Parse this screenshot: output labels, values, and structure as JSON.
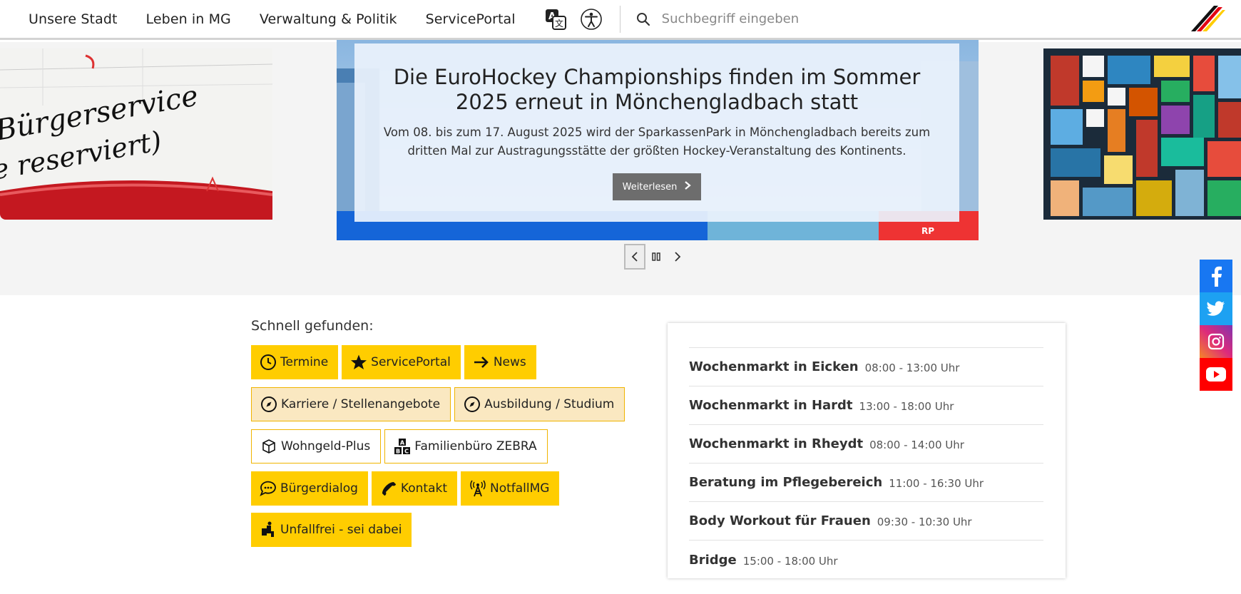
{
  "nav": {
    "items": [
      "Unsere Stadt",
      "Leben in MG",
      "Verwaltung & Politik",
      "ServicePortal"
    ]
  },
  "search": {
    "placeholder": "Suchbegriff eingeben"
  },
  "slider": {
    "left_slide_text": [
      "Bürgerservice",
      "e reserviert)"
    ],
    "title": "Die EuroHockey Championships finden im Sommer 2025 erneut in Mönchengladbach statt",
    "text": "Vom 08. bis zum 17. August 2025 wird der SparkassenPark in Mönchengladbach bereits zum dritten Mal zur Austragungsstätte der größten Hockey-Veranstaltung des Kontinents.",
    "more_label": "Weiterlesen",
    "banner_text": "RP"
  },
  "quick": {
    "title": "Schnell gefunden:",
    "rows": [
      [
        {
          "label": "Termine",
          "icon": "clock-icon"
        },
        {
          "label": "ServicePortal",
          "icon": "star-icon"
        },
        {
          "label": "News",
          "icon": "arrow-right-icon"
        }
      ],
      [
        {
          "label": "Karriere / Stellenangebote",
          "icon": "compass-icon"
        },
        {
          "label": "Ausbildung / Studium",
          "icon": "compass-icon"
        }
      ],
      [
        {
          "label": "Wohngeld-Plus",
          "icon": "cube-icon"
        },
        {
          "label": "Familienbüro ZEBRA",
          "icon": "blocks-icon"
        }
      ],
      [
        {
          "label": "Bürgerdialog",
          "icon": "chat-icon"
        },
        {
          "label": "Kontakt",
          "icon": "phone-icon"
        },
        {
          "label": "NotfallMG",
          "icon": "antenna-icon"
        }
      ],
      [
        {
          "label": "Unfallfrei - sei dabei",
          "icon": "person-icon"
        }
      ]
    ]
  },
  "events": [
    {
      "name": "Wochenmarkt in Eicken",
      "time": "08:00 - 13:00 Uhr"
    },
    {
      "name": "Wochenmarkt in Hardt",
      "time": "13:00 - 18:00 Uhr"
    },
    {
      "name": "Wochenmarkt in Rheydt",
      "time": "08:00 - 14:00 Uhr"
    },
    {
      "name": "Beratung im Pflegebereich",
      "time": "11:00 - 16:30 Uhr"
    },
    {
      "name": "Body Workout für Frauen",
      "time": "09:30 - 10:30 Uhr"
    },
    {
      "name": "Bridge",
      "time": "15:00 - 18:00 Uhr"
    }
  ],
  "social": [
    {
      "name": "facebook",
      "color": "#1877f2"
    },
    {
      "name": "twitter",
      "color": "#1da1f2"
    },
    {
      "name": "instagram",
      "color": "#e1306c"
    },
    {
      "name": "youtube",
      "color": "#ff0000"
    }
  ],
  "colors": {
    "accent_yellow": "#ffcd00",
    "beige": "#fae8c1",
    "button_gray": "#6d6d6d"
  }
}
